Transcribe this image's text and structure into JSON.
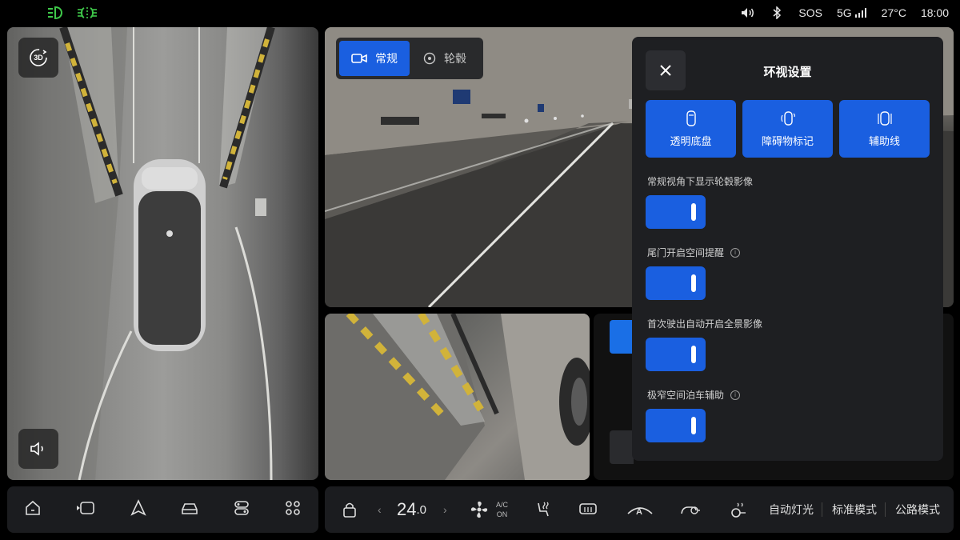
{
  "status": {
    "sos": "SOS",
    "network": "5G",
    "temperature": "27°C",
    "time": "18:00",
    "icons": [
      "headlight-icon",
      "fog-light-icon",
      "volume-icon",
      "bluetooth-icon",
      "signal-icon"
    ]
  },
  "birdseye": {
    "view_3d_label": "3D"
  },
  "view_toggle": {
    "normal": "常规",
    "wheel": "轮毂",
    "selected": "normal"
  },
  "dialog": {
    "title": "环视设置",
    "features": [
      {
        "label": "透明底盘",
        "icon": "car-outline-icon"
      },
      {
        "label": "障碍物标记",
        "icon": "obstacle-icon"
      },
      {
        "label": "辅助线",
        "icon": "guideline-icon"
      }
    ],
    "settings": [
      {
        "label": "常规视角下显示轮毂影像",
        "info": false,
        "on": true
      },
      {
        "label": "尾门开启空间提醒",
        "info": true,
        "on": true
      },
      {
        "label": "首次驶出自动开启全景影像",
        "info": true,
        "on": true
      },
      {
        "label": "极窄空间泊车辅助",
        "info": true,
        "on": true
      }
    ],
    "info_glyph": "i"
  },
  "climate": {
    "temp_main": "24",
    "temp_decimal": ".0",
    "ac_top": "A/C",
    "ac_bottom": "ON",
    "auto_light": "自动灯光",
    "standard_mode": "标准模式",
    "road_mode": "公路模式"
  },
  "colors": {
    "accent": "#1a5fe0",
    "panel": "#1e1f22",
    "green_indicator": "#3fc84a"
  }
}
